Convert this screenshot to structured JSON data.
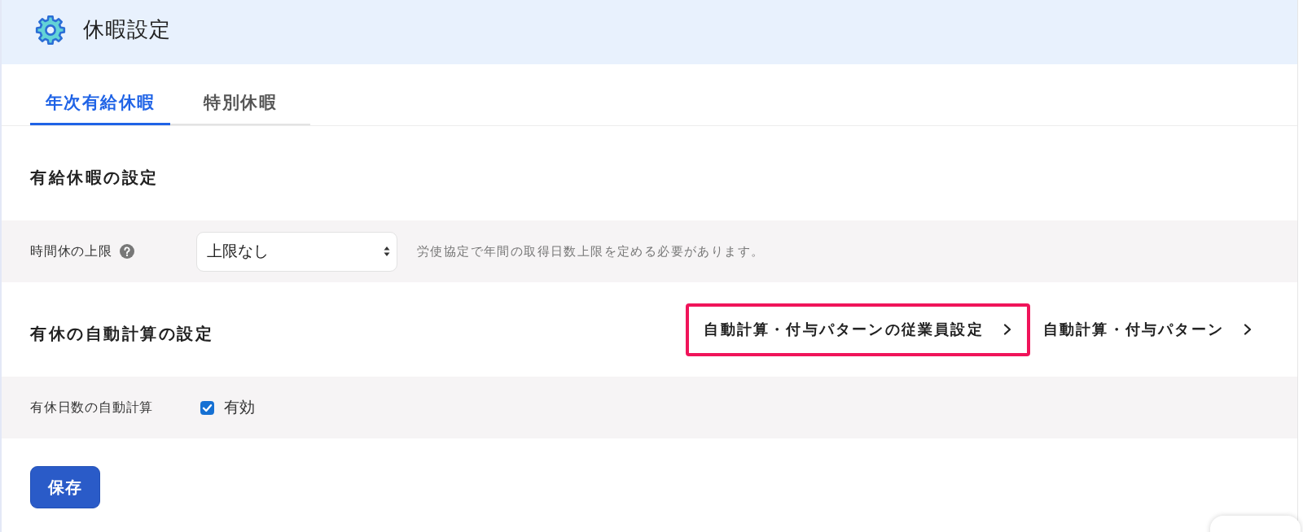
{
  "header": {
    "title": "休暇設定"
  },
  "tabs": [
    {
      "label": "年次有給休暇",
      "selected": true
    },
    {
      "label": "特別休暇",
      "selected": false
    }
  ],
  "sections": [
    {
      "heading": "有給休暇の設定",
      "rows": [
        {
          "kind": "select",
          "label": "時間休の上限",
          "help": true,
          "value": "上限なし",
          "hint": "労使協定で年間の取得日数上限を定める必要があります。"
        }
      ]
    },
    {
      "heading": "有休の自動計算の設定",
      "links": [
        {
          "label": "自動計算・付与パターンの従業員設定",
          "highlighted": true
        },
        {
          "label": "自動計算・付与パターン",
          "highlighted": false
        }
      ],
      "rows": [
        {
          "kind": "checkbox",
          "label": "有休日数の自動計算",
          "checked": true,
          "option": "有効"
        }
      ]
    }
  ],
  "save_button": {
    "label": "保存"
  }
}
